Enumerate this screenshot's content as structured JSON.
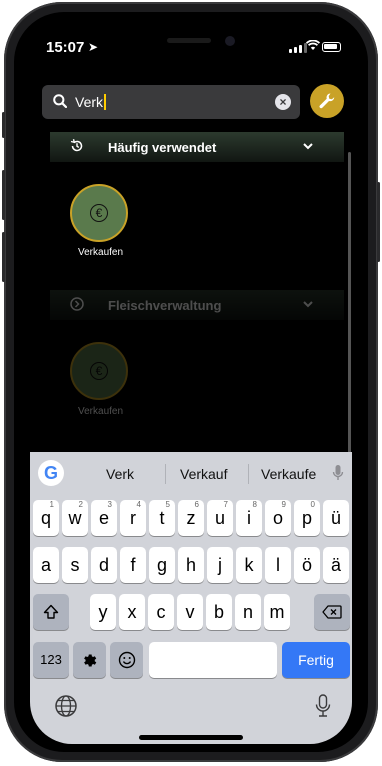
{
  "status": {
    "time": "15:07"
  },
  "search": {
    "query": "Verk"
  },
  "sections": [
    {
      "label": "Häufig verwendet",
      "tiles": [
        {
          "label": "Verkaufen"
        }
      ]
    },
    {
      "label": "Fleischverwaltung",
      "tiles": [
        {
          "label": "Verkaufen"
        }
      ]
    }
  ],
  "keyboard": {
    "suggestions": [
      "Verk",
      "Verkauf",
      "Verkaufe"
    ],
    "row1": [
      {
        "k": "q",
        "n": "1"
      },
      {
        "k": "w",
        "n": "2"
      },
      {
        "k": "e",
        "n": "3"
      },
      {
        "k": "r",
        "n": "4"
      },
      {
        "k": "t",
        "n": "5"
      },
      {
        "k": "z",
        "n": "6"
      },
      {
        "k": "u",
        "n": "7"
      },
      {
        "k": "i",
        "n": "8"
      },
      {
        "k": "o",
        "n": "9"
      },
      {
        "k": "p",
        "n": "0"
      },
      {
        "k": "ü",
        "n": ""
      }
    ],
    "row2": [
      "a",
      "s",
      "d",
      "f",
      "g",
      "h",
      "j",
      "k",
      "l",
      "ö",
      "ä"
    ],
    "row3": [
      "y",
      "x",
      "c",
      "v",
      "b",
      "n",
      "m"
    ],
    "numbers_label": "123",
    "return_label": "Fertig"
  },
  "colors": {
    "accent": "#c9a227",
    "tile": "#5a7a4c",
    "return": "#3478f6"
  }
}
